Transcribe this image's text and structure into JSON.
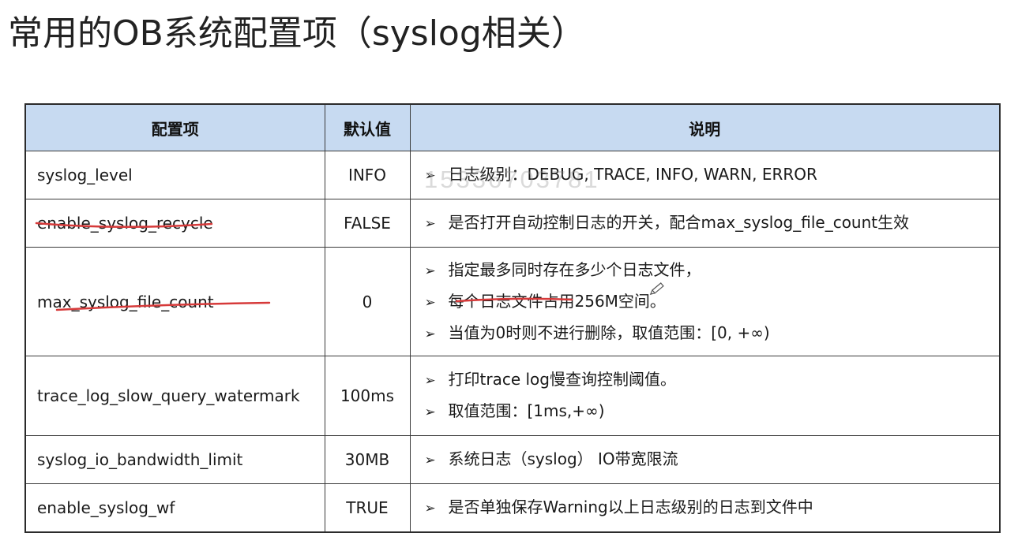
{
  "title": "常用的OB系统配置项（syslog相关）",
  "watermark": "15336703781",
  "table": {
    "headers": [
      "配置项",
      "默认值",
      "说明"
    ],
    "rows": [
      {
        "name": "syslog_level",
        "default": "INFO",
        "desc": [
          "日志级别：DEBUG, TRACE, INFO, WARN, ERROR"
        ]
      },
      {
        "name": "enable_syslog_recycle",
        "default": "FALSE",
        "desc": [
          "是否打开自动控制日志的开关，配合max_syslog_file_count生效"
        ]
      },
      {
        "name": "max_syslog_file_count",
        "default": "0",
        "desc": [
          "指定最多同时存在多少个日志文件，",
          "每个日志文件占用256M空间。",
          "当值为0时则不进行删除，取值范围：[0, +∞)"
        ]
      },
      {
        "name": "trace_log_slow_query_watermark",
        "default": "100ms",
        "desc": [
          "打印trace log慢查询控制阈值。",
          "取值范围：[1ms,+∞)"
        ]
      },
      {
        "name": "syslog_io_bandwidth_limit",
        "default": "30MB",
        "desc": [
          "系统日志（syslog） IO带宽限流"
        ]
      },
      {
        "name": "enable_syslog_wf",
        "default": "TRUE",
        "desc": [
          "是否单独保存Warning以上日志级别的日志到文件中"
        ]
      }
    ]
  },
  "arrow_glyph": "➢",
  "colors": {
    "header_bg": "#c7daf1",
    "annotation": "#d63a3a"
  }
}
